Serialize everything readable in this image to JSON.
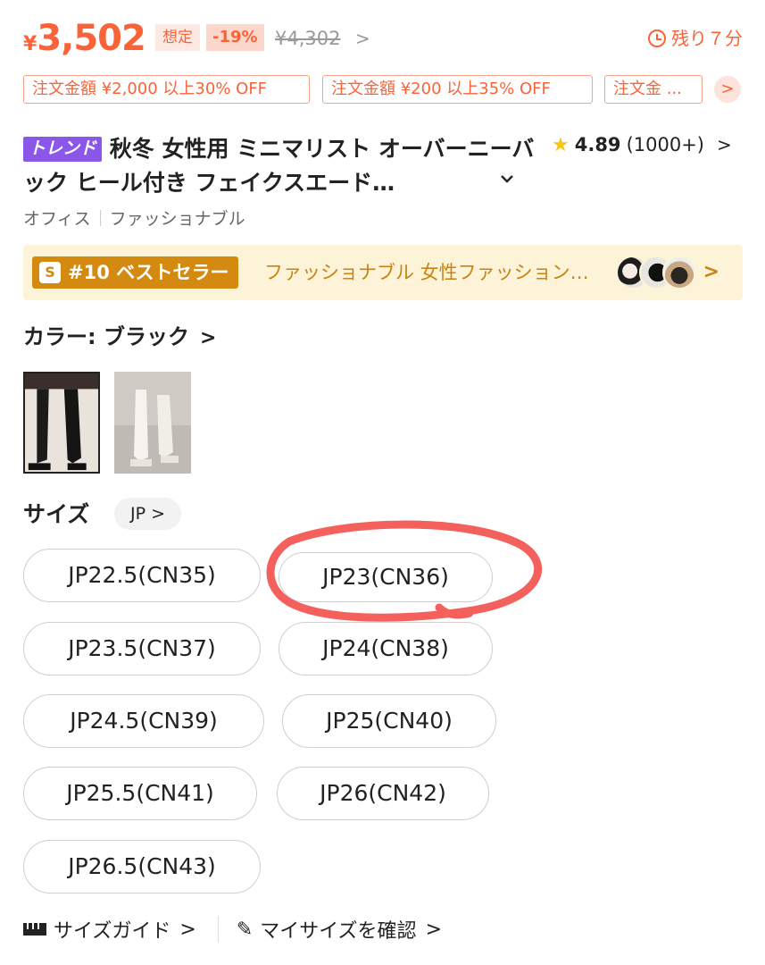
{
  "price": {
    "currency": "¥",
    "amount": "3,502",
    "estimate_label": "想定",
    "discount": "-19%",
    "original": "¥4,302",
    "chevron": ">"
  },
  "countdown": {
    "text": "残り７分"
  },
  "coupons": [
    {
      "label": "注文金額 ¥2,000 以上30% OFF"
    },
    {
      "label": "注文金額 ¥200 以上35% OFF"
    },
    {
      "label": "注文金 ..."
    }
  ],
  "coupon_more": ">",
  "product": {
    "badge": "トレンド",
    "title": "秋冬 女性用 ミニマリスト オーバーニーバック ヒール付き フェイクスエード…",
    "expand_icon": "chevron-down-icon",
    "rating": "4.89",
    "review_count": "(1000+)",
    "tags": [
      "オフィス",
      "ファッショナブル"
    ]
  },
  "bestseller": {
    "badge_icon": "S",
    "rank": "#10 ベストセラー",
    "category": "ファッショナブル 女性ファッション…",
    "chevron": ">"
  },
  "color": {
    "label": "カラー: ブラック",
    "options": [
      {
        "name": "ブラック",
        "selected": true,
        "tone": "#2a2a2a"
      },
      {
        "name": "ホワイト",
        "selected": false,
        "tone": "#f1ede6"
      }
    ]
  },
  "size": {
    "label": "サイズ",
    "system": "JP >",
    "options": [
      "JP22.5(CN35)",
      "JP23(CN36)",
      "JP23.5(CN37)",
      "JP24(CN38)",
      "JP24.5(CN39)",
      "JP25(CN40)",
      "JP25.5(CN41)",
      "JP26(CN42)",
      "JP26.5(CN43)"
    ],
    "highlighted": "JP23(CN36)",
    "highlight_color": "#f2443f"
  },
  "links": {
    "size_guide": "サイズガイド",
    "my_size": "マイサイズを確認"
  },
  "colors": {
    "accent": "#fa6338",
    "trend": "#8a57ea",
    "gold": "#d48a11"
  }
}
